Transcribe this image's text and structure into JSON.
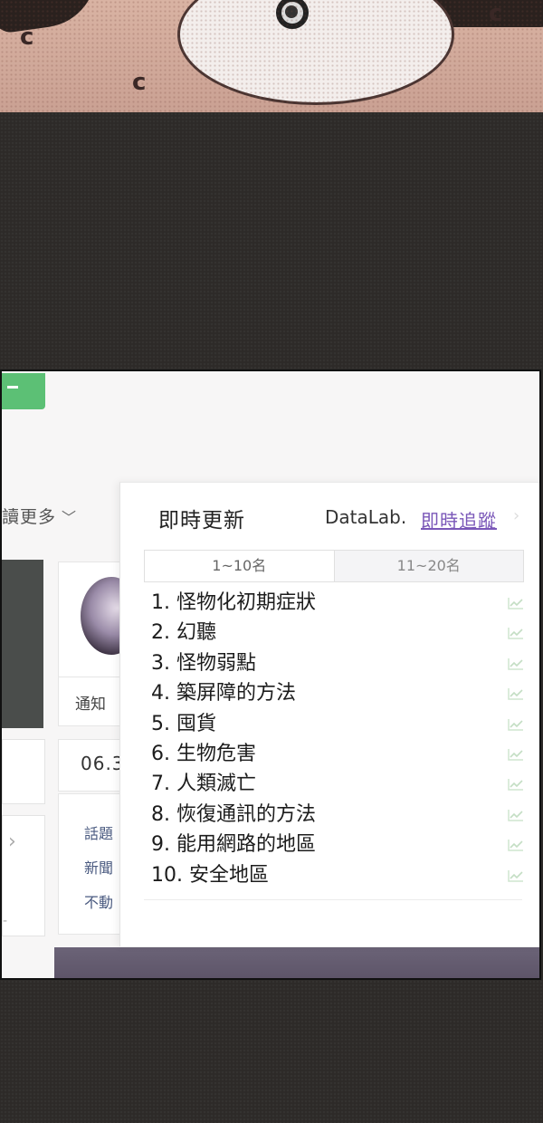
{
  "panel": {
    "title": "即時更新",
    "datalab": "DataLab.",
    "track_link": "即時追蹤",
    "tabs": [
      "1~10名",
      "11~20名"
    ],
    "items": [
      "1. 怪物化初期症狀",
      "2. 幻聽",
      "3. 怪物弱點",
      "4. 築屏障的方法",
      "5. 囤貨",
      "6. 生物危害",
      "7. 人類滅亡",
      "8. 恢復通訊的方法",
      "9. 能用網路的地區",
      "10. 安全地區"
    ]
  },
  "background_page": {
    "more_label": "讀更多",
    "notify_label": "通知",
    "date_label": "06.3",
    "links": [
      "話題",
      "新聞",
      "不動"
    ]
  },
  "colors": {
    "accent_link": "#7a57b8",
    "green_button": "#5cc075",
    "trend_icon": "#c9e3c9"
  }
}
